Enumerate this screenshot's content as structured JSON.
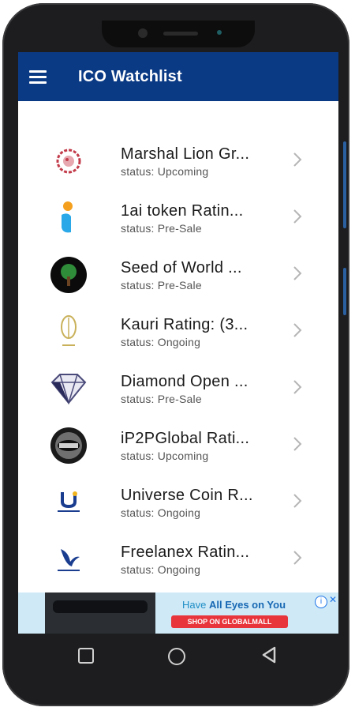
{
  "app": {
    "title": "ICO Watchlist"
  },
  "colors": {
    "appbar": "#0b3a85",
    "ad_button": "#e8343b"
  },
  "items": [
    {
      "title": "Marshal Lion Gr...",
      "status": "status: Upcoming",
      "icon": "lion-logo-icon"
    },
    {
      "title": "1ai token Ratin...",
      "status": "status: Pre-Sale",
      "icon": "1ai-logo-icon"
    },
    {
      "title": "Seed of World ...",
      "status": "status: Pre-Sale",
      "icon": "tree-logo-icon"
    },
    {
      "title": "Kauri Rating: (3...",
      "status": "status: Ongoing",
      "icon": "leaf-logo-icon"
    },
    {
      "title": "Diamond Open ...",
      "status": "status: Pre-Sale",
      "icon": "diamond-logo-icon"
    },
    {
      "title": "iP2PGlobal Rati...",
      "status": "status: Upcoming",
      "icon": "ip2p-logo-icon"
    },
    {
      "title": "Universe Coin R...",
      "status": "status: Ongoing",
      "icon": "universe-logo-icon"
    },
    {
      "title": "Freelanex Ratin...",
      "status": "status: Ongoing",
      "icon": "bird-logo-icon"
    }
  ],
  "ad": {
    "headline_pre": "Have ",
    "headline_bold": "All Eyes on You",
    "button": "SHOP ON GLOBALMALL"
  }
}
